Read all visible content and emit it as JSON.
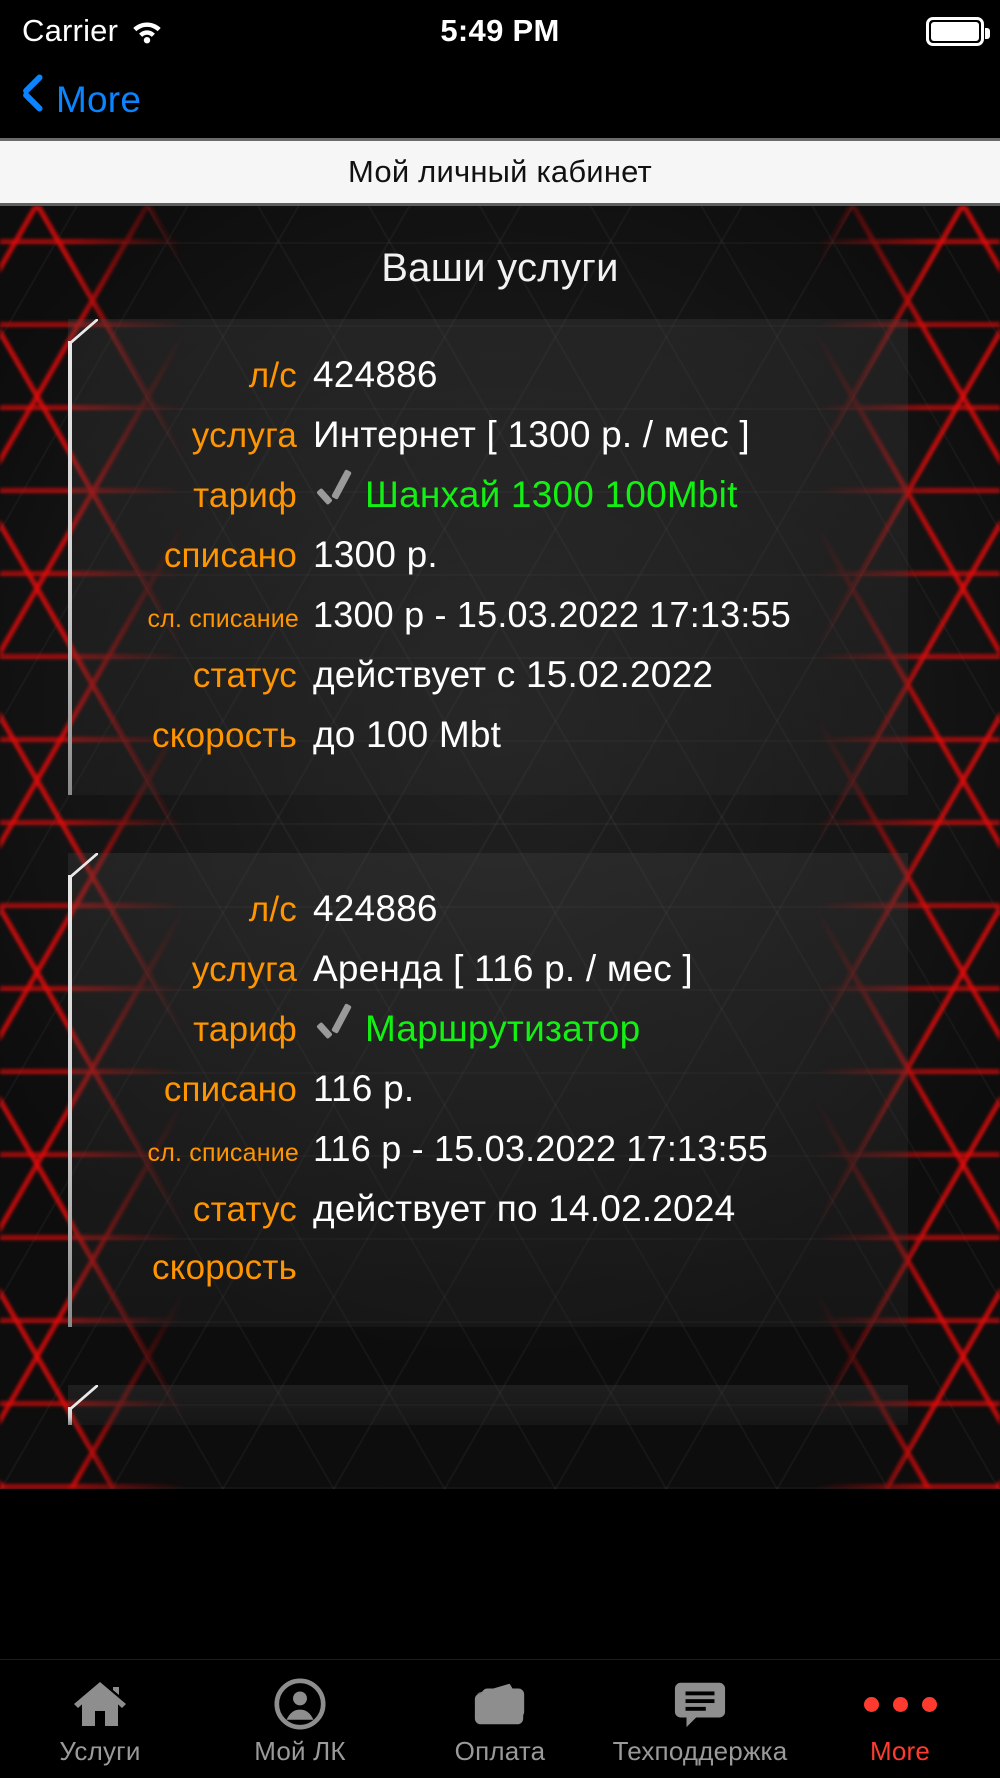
{
  "status_bar": {
    "carrier": "Carrier",
    "wifi_icon": "wifi-icon",
    "time": "5:49 PM",
    "battery_icon": "battery-full-icon"
  },
  "nav_bar": {
    "back_icon": "chevron-left-icon",
    "back_label": "More"
  },
  "title_bar": {
    "title": "Мой личный кабинет"
  },
  "main": {
    "section_title": "Ваши услуги",
    "labels": {
      "account": "л/с",
      "service": "услуга",
      "tariff": "тариф",
      "charged": "списано",
      "next_charge": "сл. списание",
      "status": "статус",
      "speed": "скорость"
    },
    "cards": [
      {
        "account": "424886",
        "service": "Интернет [ 1300 р. / мес ]",
        "tariff": "Шанхай 1300 100Mbit",
        "tariff_check_icon": "checkmark-icon",
        "charged": "1300 р.",
        "next_charge": "1300 р -  15.03.2022 17:13:55",
        "status": "действует с 15.02.2022",
        "speed": "до 100 Mbt"
      },
      {
        "account": "424886",
        "service": "Аренда [ 116 р. / мес ]",
        "tariff": "Маршрутизатор",
        "tariff_check_icon": "checkmark-icon",
        "charged": "116 р.",
        "next_charge": "116 р -  15.03.2022 17:13:55",
        "status": "действует по 14.02.2024",
        "speed": ""
      }
    ]
  },
  "tab_bar": {
    "tabs": [
      {
        "label": "Услуги",
        "icon": "home-icon",
        "active": false
      },
      {
        "label": "Мой ЛК",
        "icon": "person-circle-icon",
        "active": false
      },
      {
        "label": "Оплата",
        "icon": "cards-icon",
        "active": false
      },
      {
        "label": "Техподдержка",
        "icon": "chat-bubble-icon",
        "active": false
      },
      {
        "label": "More",
        "icon": "more-dots-icon",
        "active": true
      }
    ]
  },
  "colors": {
    "label_orange": "#ff9500",
    "value_white": "#ffffff",
    "tariff_green": "#13f113",
    "accent_blue": "#0a84ff",
    "active_tab_red": "#ff3b30",
    "hex_red": "#eb0a0a"
  }
}
